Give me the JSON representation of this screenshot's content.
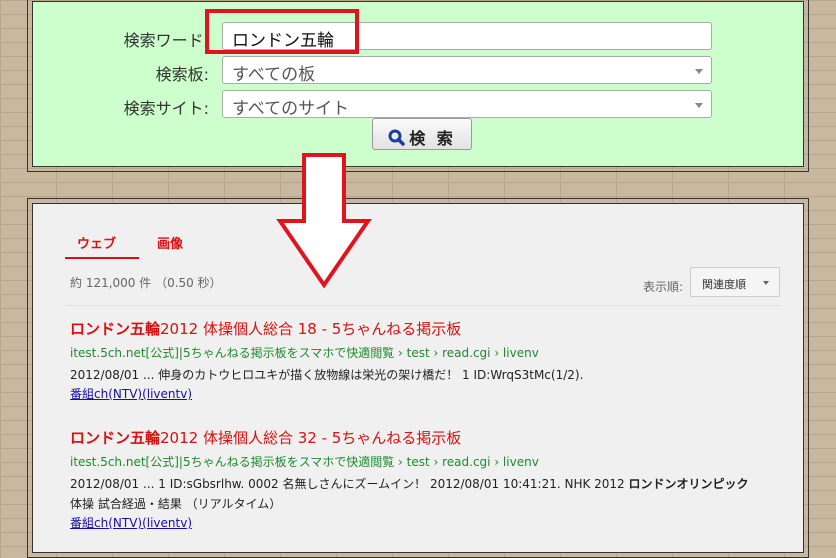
{
  "search_form": {
    "keyword_label": "検索ワード:",
    "keyword_value": "ロンドン五輪",
    "board_label": "検索板:",
    "board_value": "すべての板",
    "site_label": "検索サイト:",
    "site_value": "すべてのサイト",
    "search_button": "検 索"
  },
  "results": {
    "tabs": [
      "ウェブ",
      "画像"
    ],
    "count_text": "約 121,000 件 （0.50 秒）",
    "sort_label": "表示順:",
    "sort_value": "関連度順",
    "items": [
      {
        "title_bold": "ロンドン五輪",
        "title_rest": "2012 体操個人総合 18 - 5ちゃんねる掲示板",
        "url": "itest.5ch.net[公式]|5ちゃんねる掲示板をスマホで快適閲覧 › test › read.cgi › livenv",
        "snippet_date": "2012/08/01",
        "snippet_text": " ... 伸身のカトウヒロユキが描く放物線は栄光の架け橋だ！ 1 ID:WrqS3tMc(1/2).",
        "snippet_bold": "",
        "snippet_after": "",
        "link": "番組ch(NTV)(liventv)"
      },
      {
        "title_bold": "ロンドン五輪",
        "title_rest": "2012 体操個人総合 32 - 5ちゃんねる掲示板",
        "url": "itest.5ch.net[公式]|5ちゃんねる掲示板をスマホで快適閲覧 › test › read.cgi › livenv",
        "snippet_date": "2012/08/01",
        "snippet_text": " ... 1 ID:sGbsrlhw. 0002 名無しさんにズームイン！ 2012/08/01 10:41:21. NHK 2012 ",
        "snippet_bold": "ロンドンオリンピック",
        "snippet_after": "体操 試合経過・結果 （リアルタイム）",
        "link": "番組ch(NTV)(liventv)"
      }
    ]
  },
  "colors": {
    "form_bg": "#ccffcc",
    "highlight": "#e0141e",
    "title_red": "#d81010",
    "url_green": "#1e8a2e",
    "link_blue": "#1a0dab"
  },
  "icons": {
    "search_button_icon": "magnifier-icon",
    "annotation": "down-arrow-icon"
  }
}
